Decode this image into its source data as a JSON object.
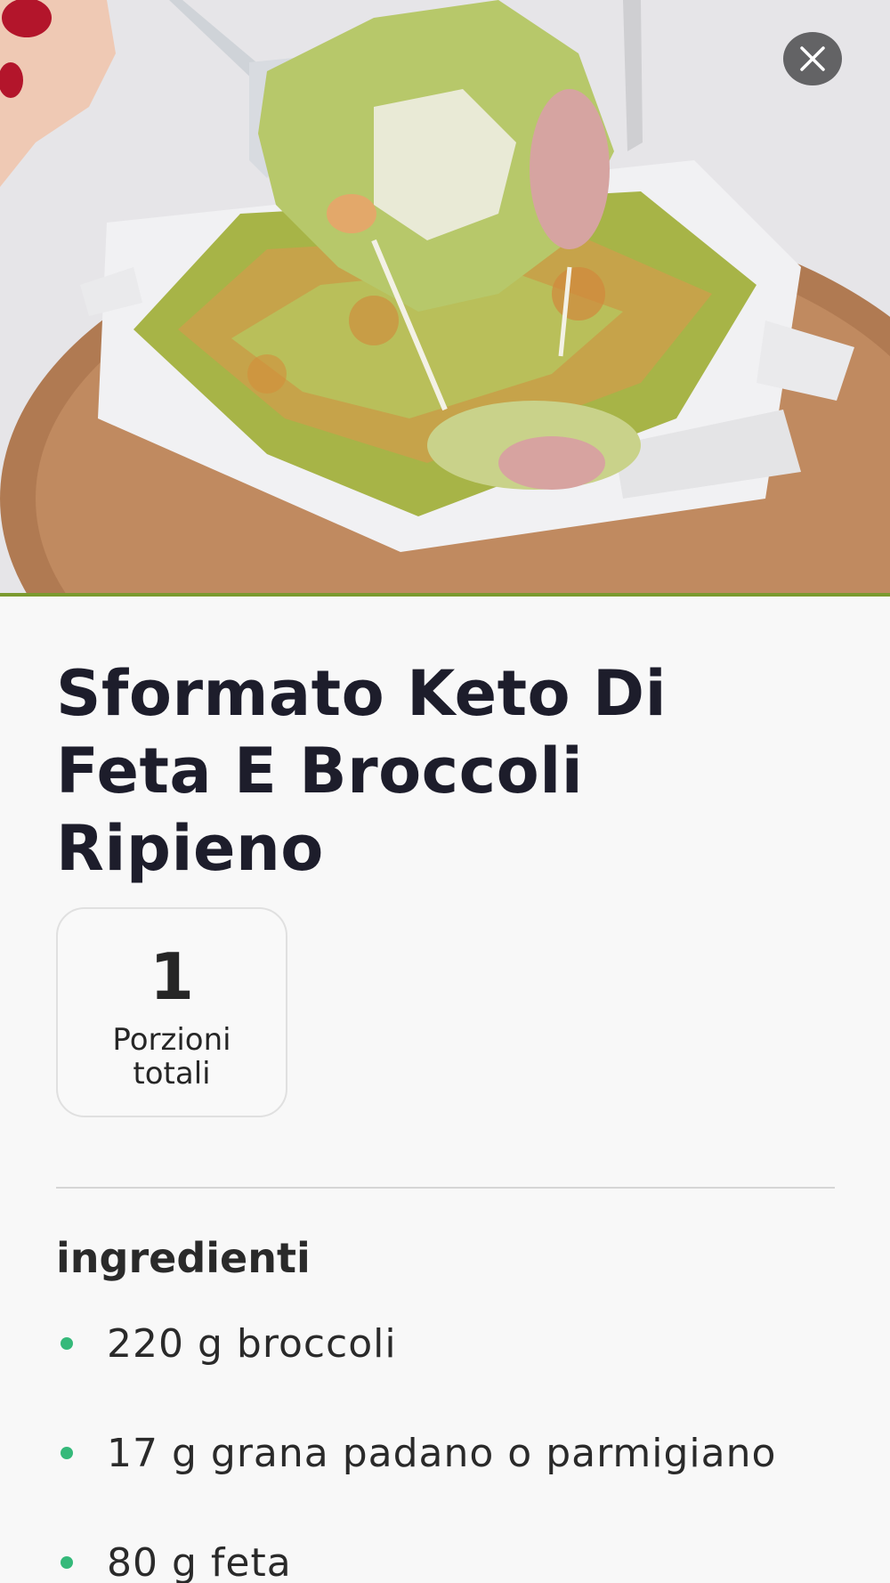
{
  "hero": {
    "image_description": "baked broccoli feta casserole in white dish",
    "close_icon": "close-icon"
  },
  "recipe": {
    "title": "Sformato Keto Di Feta E Broccoli Ripieno",
    "servings": {
      "value": "1",
      "label": "Porzioni totali"
    }
  },
  "ingredients": {
    "section_title": "ingredienti",
    "items": [
      {
        "text": "220 g broccoli"
      },
      {
        "text": "17 g grana padano o parmigiano"
      },
      {
        "text": "80 g feta"
      }
    ]
  },
  "colors": {
    "bullet": "#35b97a",
    "hero_border": "#7b9a2f",
    "title": "#1d1d2b"
  }
}
